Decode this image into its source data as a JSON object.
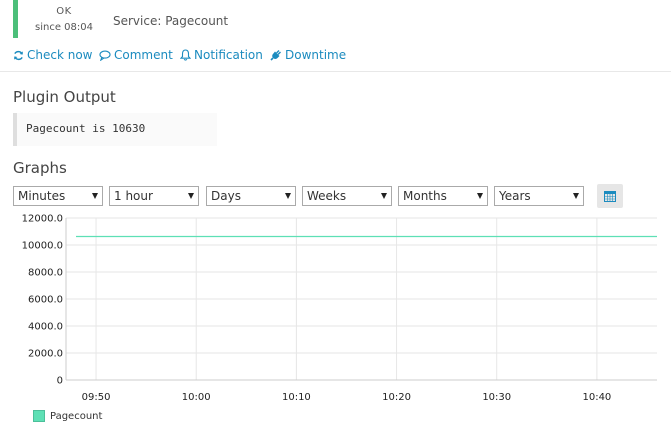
{
  "status": {
    "state": "OK",
    "since": "since 08:04",
    "service_label": "Service: Pagecount",
    "color": "#4cbf7a"
  },
  "actions": [
    {
      "label": "Check now",
      "icon": "refresh-icon"
    },
    {
      "label": "Comment",
      "icon": "comment-icon"
    },
    {
      "label": "Notification",
      "icon": "bell-icon"
    },
    {
      "label": "Downtime",
      "icon": "plug-icon"
    }
  ],
  "plugin_output": {
    "heading": "Plugin Output",
    "text": "Pagecount is 10630"
  },
  "graphs": {
    "heading": "Graphs",
    "selects": [
      {
        "value": "Minutes"
      },
      {
        "value": "1 hour"
      },
      {
        "value": "Days"
      },
      {
        "value": "Weeks"
      },
      {
        "value": "Months"
      },
      {
        "value": "Years"
      }
    ],
    "calendar_icon": "calendar-icon",
    "accent_color": "#1b8bbf"
  },
  "chart_data": {
    "type": "line",
    "series": [
      {
        "name": "Pagecount",
        "color": "#5ee0b5",
        "points": [
          [
            "09:48",
            10630
          ],
          [
            "09:50",
            10630
          ],
          [
            "10:00",
            10630
          ],
          [
            "10:10",
            10630
          ],
          [
            "10:20",
            10630
          ],
          [
            "10:30",
            10630
          ],
          [
            "10:40",
            10630
          ],
          [
            "10:46",
            10630
          ]
        ]
      }
    ],
    "x_ticks": [
      "09:50",
      "10:00",
      "10:10",
      "10:20",
      "10:30",
      "10:40"
    ],
    "x_range": [
      "09:47",
      "10:46"
    ],
    "y_ticks": [
      "0",
      "2000.0",
      "4000.0",
      "6000.0",
      "8000.0",
      "10000.0",
      "12000.0"
    ],
    "ylim": [
      0,
      12000
    ],
    "grid": true,
    "legend_placement": "bottom-left"
  }
}
